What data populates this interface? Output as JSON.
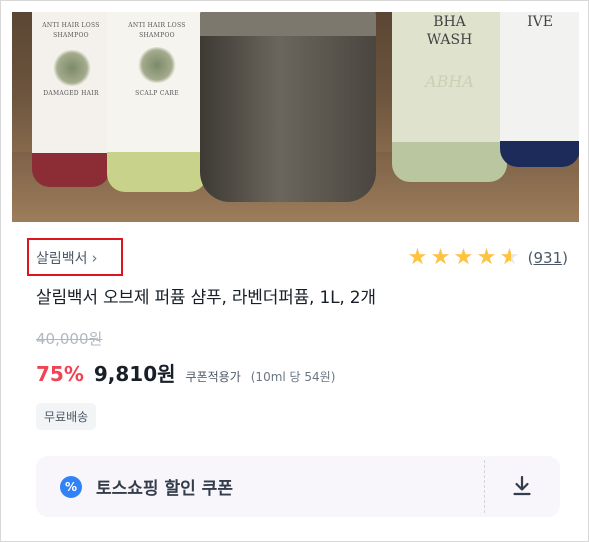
{
  "image": {
    "bottle_labels": [
      {
        "title": "ANTI HAIR LOSS",
        "subtitle": "SHAMPOO",
        "caption": "DAMAGED HAIR"
      },
      {
        "title": "ANTI HAIR LOSS",
        "subtitle": "SHAMPOO",
        "caption": "SCALP CARE"
      },
      {
        "title": "BHA",
        "subtitle": "WASH",
        "caption": "ABHA"
      },
      {
        "title": "IVE",
        "subtitle": "",
        "caption": ""
      }
    ]
  },
  "brand": {
    "name": "살림백서",
    "chevron": "›"
  },
  "rating": {
    "value": 4.5,
    "max": 5,
    "review_count": "931",
    "open_paren": "(",
    "close_paren": ")"
  },
  "product": {
    "title": "살림백서 오브제 퍼퓸 샴푸, 라벤더퍼퓸, 1L, 2개"
  },
  "pricing": {
    "original": "40,000원",
    "discount": "75%",
    "price": "9,810원",
    "coupon_applied": "쿠폰적용가",
    "unit_price": "(10ml 당 54원)"
  },
  "shipping": {
    "badge": "무료배송"
  },
  "coupon": {
    "icon_symbol": "%",
    "label": "토스쇼핑 할인 쿠폰"
  },
  "colors": {
    "discount": "#f04452",
    "star": "#ffc342",
    "coupon_icon": "#3182f6",
    "highlight_box": "#e0141e"
  }
}
